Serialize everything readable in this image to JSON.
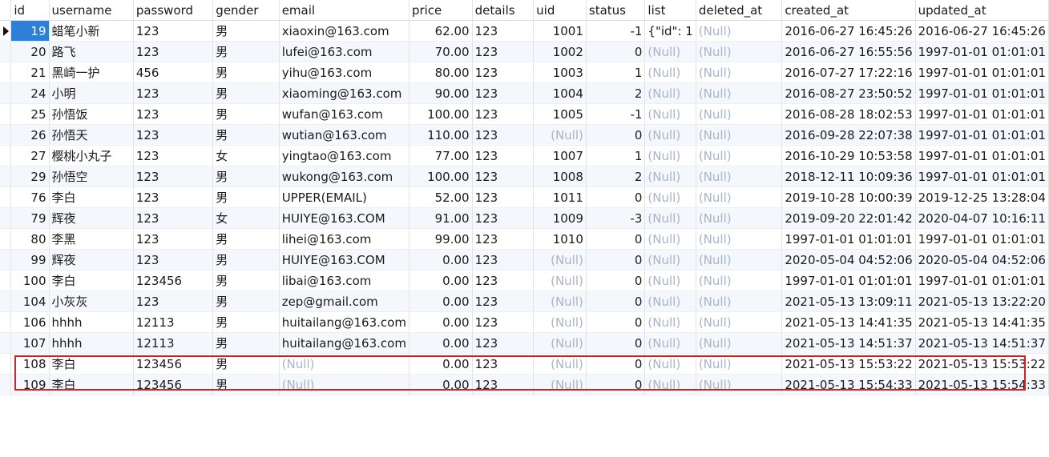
{
  "columns": [
    "id",
    "username",
    "password",
    "gender",
    "email",
    "price",
    "details",
    "uid",
    "status",
    "list",
    "deleted_at",
    "created_at",
    "updated_at"
  ],
  "null_text": "(Null)",
  "rows": [
    {
      "id": "19",
      "username": "蜡笔小新",
      "password": "123",
      "gender": "男",
      "email": "xiaoxin@163.com",
      "price": "62.00",
      "details": "123",
      "uid": "1001",
      "status": "-1",
      "list": "{\"id\": 1",
      "deleted_at": null,
      "created_at": "2016-06-27 16:45:26",
      "updated_at": "2016-06-27 16:45:26"
    },
    {
      "id": "20",
      "username": "路飞",
      "password": "123",
      "gender": "男",
      "email": "lufei@163.com",
      "price": "70.00",
      "details": "123",
      "uid": "1002",
      "status": "0",
      "list": null,
      "deleted_at": null,
      "created_at": "2016-06-27 16:55:56",
      "updated_at": "1997-01-01 01:01:01"
    },
    {
      "id": "21",
      "username": "黑崎一护",
      "password": "456",
      "gender": "男",
      "email": "yihu@163.com",
      "price": "80.00",
      "details": "123",
      "uid": "1003",
      "status": "1",
      "list": null,
      "deleted_at": null,
      "created_at": "2016-07-27 17:22:16",
      "updated_at": "1997-01-01 01:01:01"
    },
    {
      "id": "24",
      "username": "小明",
      "password": "123",
      "gender": "男",
      "email": "xiaoming@163.com",
      "price": "90.00",
      "details": "123",
      "uid": "1004",
      "status": "2",
      "list": null,
      "deleted_at": null,
      "created_at": "2016-08-27 23:50:52",
      "updated_at": "1997-01-01 01:01:01"
    },
    {
      "id": "25",
      "username": "孙悟饭",
      "password": "123",
      "gender": "男",
      "email": "wufan@163.com",
      "price": "100.00",
      "details": "123",
      "uid": "1005",
      "status": "-1",
      "list": null,
      "deleted_at": null,
      "created_at": "2016-08-28 18:02:53",
      "updated_at": "1997-01-01 01:01:01"
    },
    {
      "id": "26",
      "username": "孙悟天",
      "password": "123",
      "gender": "男",
      "email": "wutian@163.com",
      "price": "110.00",
      "details": "123",
      "uid": null,
      "status": "0",
      "list": null,
      "deleted_at": null,
      "created_at": "2016-09-28 22:07:38",
      "updated_at": "1997-01-01 01:01:01"
    },
    {
      "id": "27",
      "username": "樱桃小丸子",
      "password": "123",
      "gender": "女",
      "email": "yingtao@163.com",
      "price": "77.00",
      "details": "123",
      "uid": "1007",
      "status": "1",
      "list": null,
      "deleted_at": null,
      "created_at": "2016-10-29 10:53:58",
      "updated_at": "1997-01-01 01:01:01"
    },
    {
      "id": "29",
      "username": "孙悟空",
      "password": "123",
      "gender": "男",
      "email": "wukong@163.com",
      "price": "100.00",
      "details": "123",
      "uid": "1008",
      "status": "2",
      "list": null,
      "deleted_at": null,
      "created_at": "2018-12-11 10:09:36",
      "updated_at": "1997-01-01 01:01:01"
    },
    {
      "id": "76",
      "username": "李白",
      "password": "123",
      "gender": "男",
      "email": "UPPER(EMAIL)",
      "price": "52.00",
      "details": "123",
      "uid": "1011",
      "status": "0",
      "list": null,
      "deleted_at": null,
      "created_at": "2019-10-28 10:00:39",
      "updated_at": "2019-12-25 13:28:04"
    },
    {
      "id": "79",
      "username": "辉夜",
      "password": "123",
      "gender": "女",
      "email": "HUIYE@163.COM",
      "price": "91.00",
      "details": "123",
      "uid": "1009",
      "status": "-3",
      "list": null,
      "deleted_at": null,
      "created_at": "2019-09-20 22:01:42",
      "updated_at": "2020-04-07 10:16:11"
    },
    {
      "id": "80",
      "username": "李黑",
      "password": "123",
      "gender": "男",
      "email": "lihei@163.com",
      "price": "99.00",
      "details": "123",
      "uid": "1010",
      "status": "0",
      "list": null,
      "deleted_at": null,
      "created_at": "1997-01-01 01:01:01",
      "updated_at": "1997-01-01 01:01:01"
    },
    {
      "id": "99",
      "username": "辉夜",
      "password": "123",
      "gender": "男",
      "email": "HUIYE@163.COM",
      "price": "0.00",
      "details": "123",
      "uid": null,
      "status": "0",
      "list": null,
      "deleted_at": null,
      "created_at": "2020-05-04 04:52:06",
      "updated_at": "2020-05-04 04:52:06"
    },
    {
      "id": "100",
      "username": "李白",
      "password": "123456",
      "gender": "男",
      "email": "libai@163.com",
      "price": "0.00",
      "details": "123",
      "uid": null,
      "status": "0",
      "list": null,
      "deleted_at": null,
      "created_at": "1997-01-01 01:01:01",
      "updated_at": "1997-01-01 01:01:01"
    },
    {
      "id": "104",
      "username": "小灰灰",
      "password": "123",
      "gender": "男",
      "email": "zep@gmail.com",
      "price": "0.00",
      "details": "123",
      "uid": null,
      "status": "0",
      "list": null,
      "deleted_at": null,
      "created_at": "2021-05-13 13:09:11",
      "updated_at": "2021-05-13 13:22:20"
    },
    {
      "id": "106",
      "username": "hhhh",
      "password": "12113",
      "gender": "男",
      "email": "huitailang@163.com",
      "price": "0.00",
      "details": "123",
      "uid": null,
      "status": "0",
      "list": null,
      "deleted_at": null,
      "created_at": "2021-05-13 14:41:35",
      "updated_at": "2021-05-13 14:41:35"
    },
    {
      "id": "107",
      "username": "hhhh",
      "password": "12113",
      "gender": "男",
      "email": "huitailang@163.com",
      "price": "0.00",
      "details": "123",
      "uid": null,
      "status": "0",
      "list": null,
      "deleted_at": null,
      "created_at": "2021-05-13 14:51:37",
      "updated_at": "2021-05-13 14:51:37"
    },
    {
      "id": "108",
      "username": "李白",
      "password": "123456",
      "gender": "男",
      "email": null,
      "price": "0.00",
      "details": "123",
      "uid": null,
      "status": "0",
      "list": null,
      "deleted_at": null,
      "created_at": "2021-05-13 15:53:22",
      "updated_at": "2021-05-13 15:53:22"
    },
    {
      "id": "109",
      "username": "李白",
      "password": "123456",
      "gender": "男",
      "email": null,
      "price": "0.00",
      "details": "123",
      "uid": null,
      "status": "0",
      "list": null,
      "deleted_at": null,
      "created_at": "2021-05-13 15:54:33",
      "updated_at": "2021-05-13 15:54:33"
    }
  ],
  "selected_row_index": 0,
  "highlighted_row_index": 17,
  "colors": {
    "selection": "#2f7fd6",
    "highlight_box": "#d02424",
    "null_text": "#a8b4c8",
    "alt_row": "#f4f7fb"
  },
  "icons": {
    "current_row": "triangle-right"
  }
}
